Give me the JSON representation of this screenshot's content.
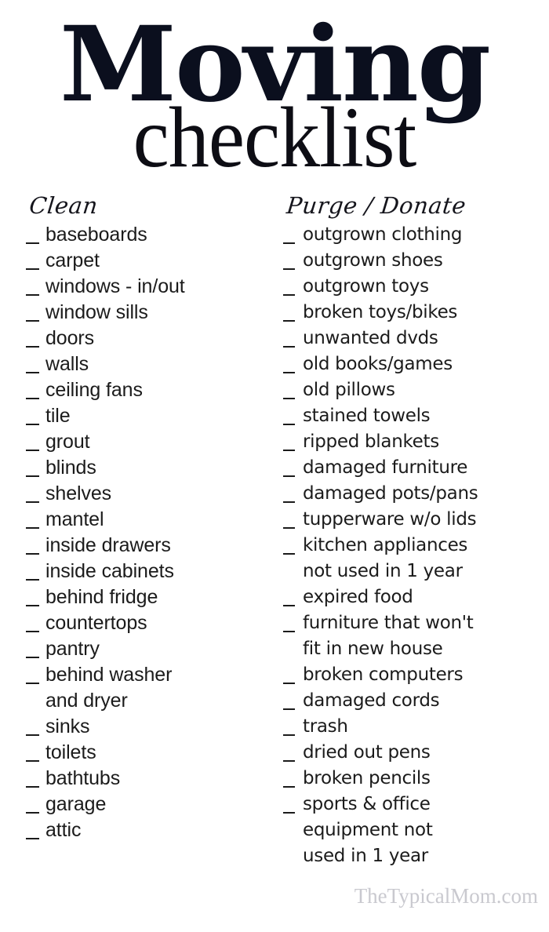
{
  "title": {
    "main": "Moving",
    "sub": "checklist"
  },
  "columns": [
    {
      "id": "clean",
      "heading": "Clean",
      "items": [
        "baseboards",
        "carpet",
        "windows - in/out",
        "window sills",
        "doors",
        "walls",
        "ceiling fans",
        "tile",
        "grout",
        "blinds",
        "shelves",
        "mantel",
        "inside drawers",
        "inside cabinets",
        "behind fridge",
        "countertops",
        "pantry",
        "behind washer\nand dryer",
        "sinks",
        "toilets",
        "bathtubs",
        "garage",
        "attic"
      ]
    },
    {
      "id": "purge-donate",
      "heading": "Purge / Donate",
      "items": [
        "outgrown clothing",
        "outgrown shoes",
        "outgrown toys",
        "broken toys/bikes",
        "unwanted dvds",
        "old books/games",
        "old pillows",
        "stained towels",
        "ripped blankets",
        "damaged furniture",
        "damaged pots/pans",
        "tupperware w/o lids",
        "kitchen appliances\nnot used in 1 year",
        "expired food",
        "furniture that won't\nfit in new house",
        "broken computers",
        "damaged cords",
        "trash",
        "dried out pens",
        "broken pencils",
        "sports & office\nequipment not\nused in 1 year"
      ]
    }
  ],
  "footer": {
    "watermark": "TheTypicalMom.com"
  },
  "colors": {
    "title": "#0b0f1e",
    "text": "#1b1b1b",
    "watermark": "#c9c9cf",
    "background": "#ffffff"
  }
}
